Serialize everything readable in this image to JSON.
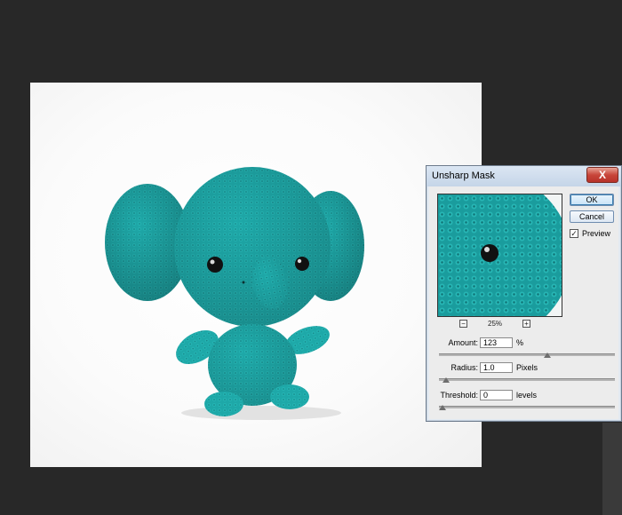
{
  "dialog": {
    "title": "Unsharp Mask",
    "close_label": "X",
    "ok_label": "OK",
    "cancel_label": "Cancel",
    "preview_label": "Preview",
    "preview_checked": true,
    "zoom_level": "25%",
    "zoom_out_label": "−",
    "zoom_in_label": "+",
    "amount": {
      "label": "Amount:",
      "value": "123",
      "unit": "%",
      "slider_fraction": 0.62
    },
    "radius": {
      "label": "Radius:",
      "value": "1.0",
      "unit": "Pixels",
      "slider_fraction": 0.02
    },
    "threshold": {
      "label": "Threshold:",
      "value": "0",
      "unit": "levels",
      "slider_fraction": 0.0
    }
  },
  "icons": {
    "close": "close-icon",
    "zoom_out": "zoom-out-icon",
    "zoom_in": "zoom-in-icon",
    "check": "checkmark-icon"
  },
  "colors": {
    "workspace": "#282828",
    "canvas_bg": "#fbfbfb",
    "toy": "#1ea8a8",
    "dialog_frame": "#e3eaf2",
    "close_red": "#c8463a"
  }
}
